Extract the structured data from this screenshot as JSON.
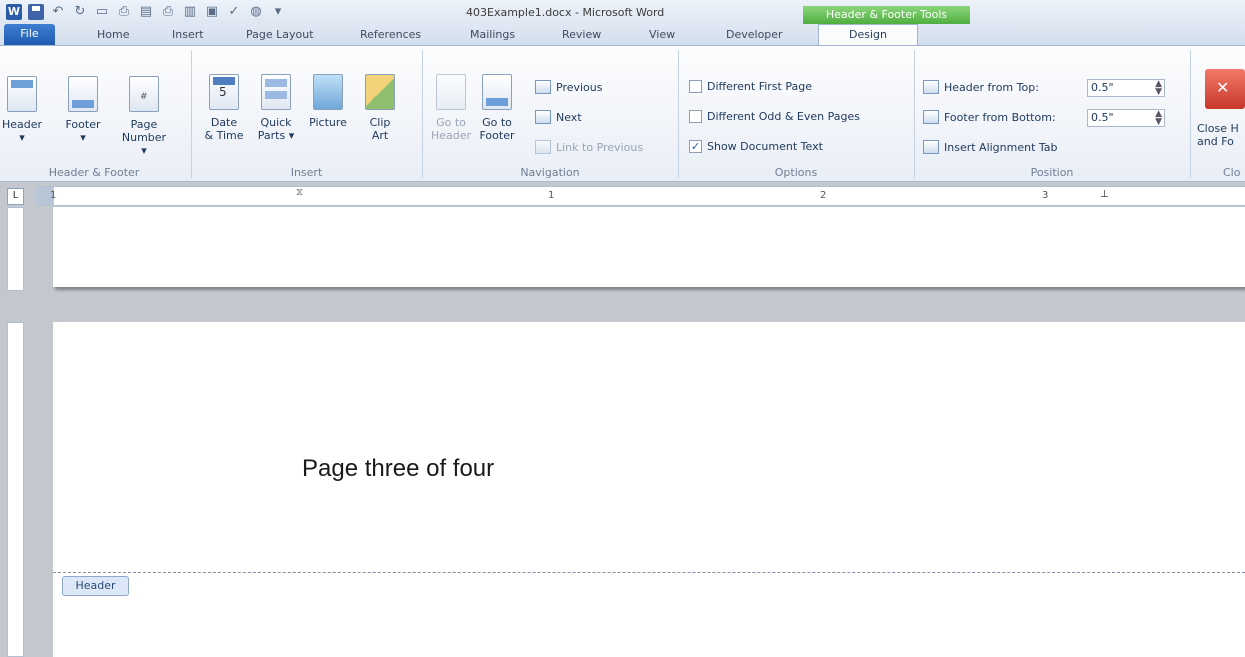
{
  "window": {
    "title": "403Example1.docx - Microsoft Word",
    "contextual_tab_group": "Header & Footer Tools"
  },
  "quick_access": [
    "word-icon",
    "save-icon",
    "undo-icon",
    "redo-icon",
    "new-icon",
    "print-preview-icon",
    "open-icon",
    "print-icon",
    "folder-icon",
    "preview-icon",
    "spelling-icon",
    "refresh-icon",
    "customize-icon"
  ],
  "tabs": {
    "file": "File",
    "home": "Home",
    "insert": "Insert",
    "page_layout": "Page Layout",
    "references": "References",
    "mailings": "Mailings",
    "review": "Review",
    "view": "View",
    "developer": "Developer",
    "design": "Design"
  },
  "ribbon": {
    "header_footer": {
      "label": "Header & Footer",
      "header": "Header",
      "footer": "Footer",
      "page_number_1": "Page",
      "page_number_2": "Number"
    },
    "insert": {
      "label": "Insert",
      "date_time_1": "Date",
      "date_time_2": "& Time",
      "quick_parts_1": "Quick",
      "quick_parts_2": "Parts",
      "picture": "Picture",
      "clip_art_1": "Clip",
      "clip_art_2": "Art"
    },
    "navigation": {
      "label": "Navigation",
      "go_to_header_1": "Go to",
      "go_to_header_2": "Header",
      "go_to_footer_1": "Go to",
      "go_to_footer_2": "Footer",
      "previous": "Previous",
      "next": "Next",
      "link_to_previous": "Link to Previous"
    },
    "options": {
      "label": "Options",
      "different_first_page": "Different First Page",
      "different_odd_even": "Different Odd & Even Pages",
      "show_document_text": "Show Document Text",
      "show_document_text_checked": true
    },
    "position": {
      "label": "Position",
      "header_from_top": "Header from Top:",
      "header_from_top_value": "0.5\"",
      "footer_from_bottom": "Footer from Bottom:",
      "footer_from_bottom_value": "0.5\"",
      "insert_alignment_tab": "Insert Alignment Tab"
    },
    "close": {
      "label": "Clo",
      "close_1": "Close H",
      "close_2": "and Fo"
    }
  },
  "ruler": {
    "numbers": [
      "1",
      "2",
      "3"
    ],
    "left_marker": "1"
  },
  "document": {
    "body_text": "Page three of four",
    "header_tag": "Header"
  }
}
